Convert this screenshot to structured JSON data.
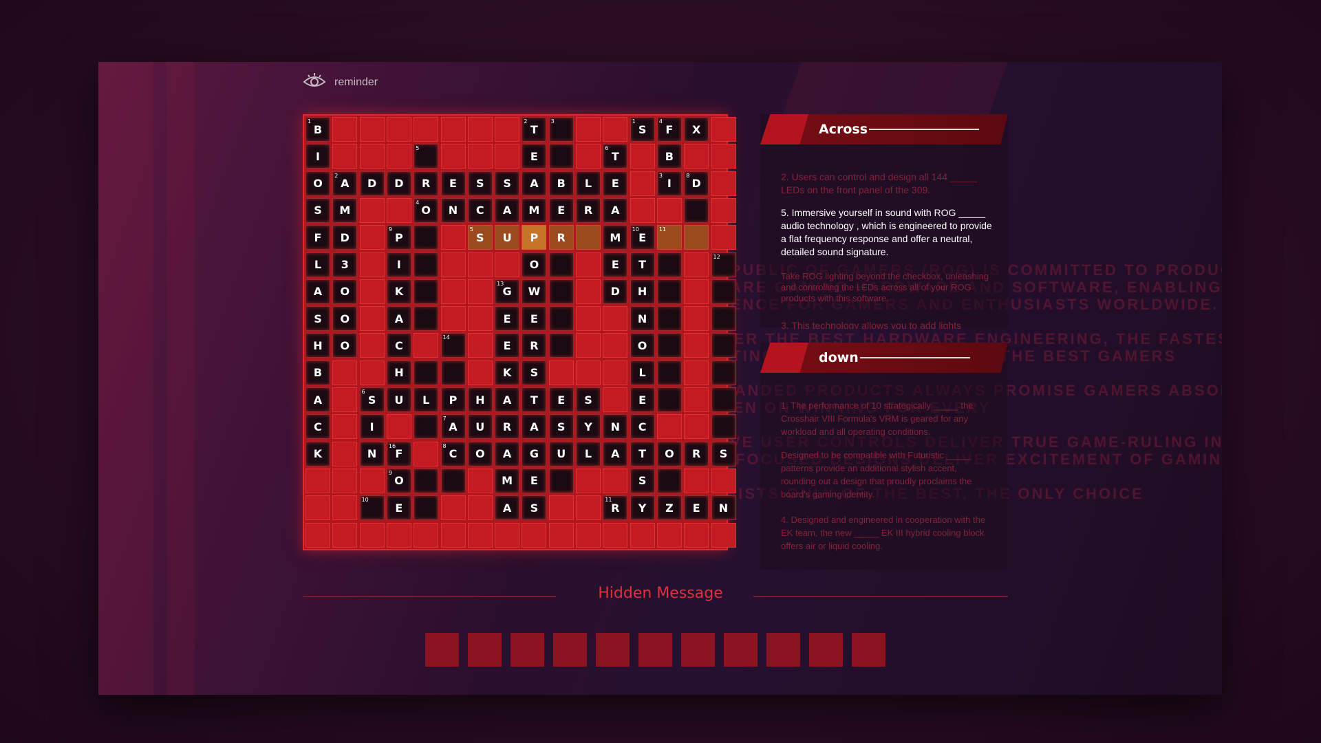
{
  "reminder": {
    "label": "reminder",
    "icon": "eye-icon"
  },
  "grid": {
    "rows": [
      "B000000T0_SFX0",
      "I0000_0E0_T0B00",
      "OADDRESSABLE_ID",
      "SM0_ONCAMERA0_0",
      "FD0P0SUPR_ME_00",
      "L30I0_O0ET000",
      "AO0K0_GW_DH00",
      "SO0A0_EE0N00",
      "HO0C_0ER_O00",
      "B00H0_KS0L00",
      "A0SULPHATES_E0",
      "C0I_AURASYNC0",
      "K0NF_COAGULATORS",
      "000O00ME0S00",
      "000E00AS0RYZEN"
    ],
    "cells": [
      [
        [
          0,
          0,
          "B",
          "1"
        ],
        [
          0,
          8,
          "T",
          "2"
        ],
        [
          0,
          9,
          "",
          "3"
        ],
        [
          0,
          12,
          "S",
          "1"
        ],
        [
          0,
          13,
          "F",
          "4"
        ],
        [
          0,
          14,
          "X",
          ""
        ]
      ],
      [
        [
          1,
          0,
          "I",
          ""
        ],
        [
          1,
          4,
          "",
          "5"
        ],
        [
          1,
          8,
          "E",
          ""
        ],
        [
          1,
          9,
          "",
          ""
        ],
        [
          1,
          11,
          "T",
          "6"
        ],
        [
          1,
          13,
          "B",
          ""
        ]
      ],
      [
        [
          2,
          0,
          "O",
          ""
        ],
        [
          2,
          1,
          "A",
          "2"
        ],
        [
          2,
          2,
          "D",
          ""
        ],
        [
          2,
          3,
          "D",
          ""
        ],
        [
          2,
          4,
          "R",
          ""
        ],
        [
          2,
          5,
          "E",
          ""
        ],
        [
          2,
          6,
          "S",
          ""
        ],
        [
          2,
          7,
          "S",
          ""
        ],
        [
          2,
          8,
          "A",
          ""
        ],
        [
          2,
          9,
          "B",
          ""
        ],
        [
          2,
          10,
          "L",
          ""
        ],
        [
          2,
          11,
          "E",
          ""
        ],
        [
          2,
          13,
          "I",
          "3"
        ],
        [
          2,
          14,
          "D",
          "8"
        ]
      ],
      [
        [
          3,
          0,
          "S",
          ""
        ],
        [
          3,
          1,
          "M",
          ""
        ],
        [
          3,
          4,
          "O",
          "4"
        ],
        [
          3,
          5,
          "N",
          ""
        ],
        [
          3,
          6,
          "C",
          ""
        ],
        [
          3,
          7,
          "A",
          ""
        ],
        [
          3,
          8,
          "M",
          ""
        ],
        [
          3,
          9,
          "E",
          ""
        ],
        [
          3,
          10,
          "R",
          ""
        ],
        [
          3,
          11,
          "A",
          ""
        ],
        [
          3,
          14,
          "",
          ""
        ]
      ],
      [
        [
          4,
          0,
          "F",
          ""
        ],
        [
          4,
          1,
          "D",
          ""
        ],
        [
          4,
          3,
          "P",
          "9"
        ],
        [
          4,
          4,
          "",
          ""
        ],
        [
          4,
          6,
          "S",
          "5"
        ],
        [
          4,
          7,
          "U",
          ""
        ],
        [
          4,
          8,
          "P",
          ""
        ],
        [
          4,
          9,
          "R",
          ""
        ],
        [
          4,
          10,
          "",
          ""
        ],
        [
          4,
          11,
          "M",
          ""
        ],
        [
          4,
          12,
          "E",
          "10"
        ],
        [
          4,
          13,
          "",
          "11"
        ],
        [
          4,
          14,
          "",
          ""
        ]
      ],
      [
        [
          5,
          0,
          "L",
          ""
        ],
        [
          5,
          1,
          "3",
          ""
        ],
        [
          5,
          3,
          "I",
          ""
        ],
        [
          5,
          4,
          "",
          ""
        ],
        [
          5,
          8,
          "O",
          ""
        ],
        [
          5,
          9,
          "",
          ""
        ],
        [
          5,
          11,
          "E",
          ""
        ],
        [
          5,
          12,
          "T",
          ""
        ],
        [
          5,
          13,
          "",
          ""
        ],
        [
          5,
          15,
          "",
          "12"
        ]
      ],
      [
        [
          6,
          0,
          "A",
          ""
        ],
        [
          6,
          1,
          "O",
          ""
        ],
        [
          6,
          3,
          "K",
          ""
        ],
        [
          6,
          4,
          "",
          ""
        ],
        [
          6,
          7,
          "G",
          "13"
        ],
        [
          6,
          8,
          "W",
          ""
        ],
        [
          6,
          9,
          "",
          ""
        ],
        [
          6,
          11,
          "D",
          ""
        ],
        [
          6,
          12,
          "H",
          ""
        ],
        [
          6,
          13,
          "",
          ""
        ],
        [
          6,
          15,
          "",
          ""
        ]
      ],
      [
        [
          7,
          0,
          "S",
          ""
        ],
        [
          7,
          1,
          "O",
          ""
        ],
        [
          7,
          3,
          "A",
          ""
        ],
        [
          7,
          4,
          "",
          ""
        ],
        [
          7,
          7,
          "E",
          ""
        ],
        [
          7,
          8,
          "E",
          ""
        ],
        [
          7,
          9,
          "",
          ""
        ],
        [
          7,
          12,
          "N",
          ""
        ],
        [
          7,
          13,
          "",
          ""
        ],
        [
          7,
          15,
          "",
          ""
        ]
      ],
      [
        [
          8,
          0,
          "H",
          ""
        ],
        [
          8,
          1,
          "O",
          ""
        ],
        [
          8,
          3,
          "C",
          ""
        ],
        [
          8,
          5,
          "",
          "14"
        ],
        [
          8,
          7,
          "E",
          ""
        ],
        [
          8,
          8,
          "R",
          ""
        ],
        [
          8,
          9,
          "",
          ""
        ],
        [
          8,
          12,
          "O",
          ""
        ],
        [
          8,
          13,
          "",
          ""
        ],
        [
          8,
          15,
          "",
          ""
        ]
      ],
      [
        [
          9,
          0,
          "B",
          ""
        ],
        [
          9,
          3,
          "H",
          ""
        ],
        [
          9,
          4,
          "",
          ""
        ],
        [
          9,
          5,
          "",
          ""
        ],
        [
          9,
          7,
          "K",
          ""
        ],
        [
          9,
          8,
          "S",
          ""
        ],
        [
          9,
          12,
          "L",
          ""
        ],
        [
          9,
          13,
          "",
          ""
        ],
        [
          9,
          15,
          "",
          ""
        ]
      ],
      [
        [
          10,
          0,
          "A",
          ""
        ],
        [
          10,
          2,
          "S",
          "6"
        ],
        [
          10,
          3,
          "U",
          ""
        ],
        [
          10,
          4,
          "L",
          ""
        ],
        [
          10,
          5,
          "P",
          ""
        ],
        [
          10,
          6,
          "H",
          ""
        ],
        [
          10,
          7,
          "A",
          ""
        ],
        [
          10,
          8,
          "T",
          ""
        ],
        [
          10,
          9,
          "E",
          ""
        ],
        [
          10,
          10,
          "S",
          ""
        ],
        [
          10,
          12,
          "E",
          ""
        ],
        [
          10,
          13,
          "",
          ""
        ],
        [
          10,
          15,
          "",
          ""
        ]
      ],
      [
        [
          11,
          0,
          "C",
          ""
        ],
        [
          11,
          2,
          "I",
          ""
        ],
        [
          11,
          4,
          "",
          ""
        ],
        [
          11,
          5,
          "A",
          "7"
        ],
        [
          11,
          6,
          "U",
          ""
        ],
        [
          11,
          7,
          "R",
          ""
        ],
        [
          11,
          8,
          "A",
          ""
        ],
        [
          11,
          9,
          "S",
          ""
        ],
        [
          11,
          10,
          "Y",
          ""
        ],
        [
          11,
          11,
          "N",
          ""
        ],
        [
          11,
          12,
          "C",
          ""
        ],
        [
          11,
          15,
          "",
          ""
        ]
      ],
      [
        [
          12,
          0,
          "K",
          ""
        ],
        [
          12,
          2,
          "N",
          ""
        ],
        [
          12,
          3,
          "F",
          "16"
        ],
        [
          12,
          5,
          "C",
          "8"
        ],
        [
          12,
          6,
          "O",
          ""
        ],
        [
          12,
          7,
          "A",
          ""
        ],
        [
          12,
          8,
          "G",
          ""
        ],
        [
          12,
          9,
          "U",
          ""
        ],
        [
          12,
          10,
          "L",
          ""
        ],
        [
          12,
          11,
          "A",
          ""
        ],
        [
          12,
          12,
          "T",
          ""
        ],
        [
          12,
          13,
          "O",
          ""
        ],
        [
          12,
          14,
          "R",
          ""
        ],
        [
          12,
          15,
          "S",
          ""
        ]
      ],
      [
        [
          13,
          3,
          "O",
          "9"
        ],
        [
          13,
          4,
          "",
          ""
        ],
        [
          13,
          5,
          "",
          ""
        ],
        [
          13,
          7,
          "M",
          ""
        ],
        [
          13,
          8,
          "E",
          ""
        ],
        [
          13,
          9,
          "",
          ""
        ],
        [
          13,
          12,
          "S",
          ""
        ],
        [
          13,
          13,
          "",
          ""
        ]
      ],
      [
        [
          14,
          2,
          "",
          "10"
        ],
        [
          14,
          3,
          "E",
          ""
        ],
        [
          14,
          4,
          "",
          ""
        ],
        [
          14,
          7,
          "A",
          ""
        ],
        [
          14,
          8,
          "S",
          ""
        ],
        [
          14,
          11,
          "R",
          "11"
        ],
        [
          14,
          12,
          "Y",
          ""
        ],
        [
          14,
          13,
          "Z",
          ""
        ],
        [
          14,
          14,
          "E",
          ""
        ],
        [
          14,
          15,
          "N",
          ""
        ]
      ]
    ]
  },
  "across": {
    "title": "Across",
    "clues": [
      "2. Users can control and design all 144 _____ LEDs on the front panel of the 309.",
      "5. Immersive yourself in sound with ROG _____ audio technology , which is engineered to provide a flat frequency response and offer a neutral, detailed sound signature.",
      "Take ROG lighting beyond the checkbox, unleashing and controlling the LEDs across all of your ROG products with this software.",
      "3. This technology allows you to add lights"
    ]
  },
  "down": {
    "title": "down",
    "clues": [
      "1. The performance of 10 strategically _____ the Crosshair VIII Formula's VRM is geared for any workload and all operating conditions.",
      "Designed to be compatible with Futuristic _____ patterns provide an additional stylish accent, rounding out a design that proudly proclaims the board's gaming identity.",
      "4. Designed and engineered in cooperation with the EK team, the new _____ EK III hybrid cooling block offers air or liquid cooling."
    ]
  },
  "background_text": [
    "THE REPUBLIC OF GAMERS (ROG) IS COMMITTED TO PRODUCING",
    "HARDWARE GAMING HARDWARE AND SOFTWARE, ENABLING THE",
    "EXPERIENCE FOR GAMERS AND ENTHUSIASTS WORLDWIDE.",
    "WE OFFER THE BEST HARDWARE ENGINEERING, THE FASTEST AND",
    "INNOVATING PRODUCTS THAT TURN THE BEST GAMERS",
    "OUR BRANDED PRODUCTS ALWAYS PROMISE GAMERS ABSOLUTE",
    "AND KEEN ON WINNING FOR EVERY",
    "INTUITIVE USER CONTROLS DELIVER TRUE GAME-RULING IN",
    "GAMER FOCUSED DESIGNS DELIVER EXCITEMENT OF GAMING",
    "IT CONSISTS ONLY OF THE BEST, THE ONLY CHOICE"
  ],
  "hidden_message": {
    "title": "Hidden Message",
    "box_count": 11
  },
  "colors": {
    "accent": "#e0303c",
    "grid_red": "#c41a22",
    "highlight": "#c67428"
  }
}
